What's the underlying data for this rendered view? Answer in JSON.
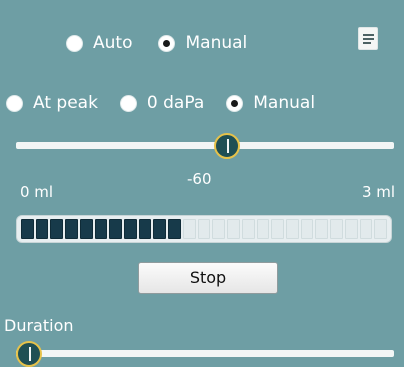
{
  "mode_group": {
    "options": [
      {
        "label": "Auto",
        "checked": false
      },
      {
        "label": "Manual",
        "checked": true
      }
    ]
  },
  "notes_icon": "notes-icon",
  "pressure_group": {
    "options": [
      {
        "label": "At peak",
        "checked": false
      },
      {
        "label": "0 daPa",
        "checked": false
      },
      {
        "label": "Manual",
        "checked": true
      }
    ]
  },
  "pressure_slider": {
    "level": 0.58
  },
  "scale": {
    "min_label": "0 ml",
    "current_label": "-60",
    "max_label": "3 ml"
  },
  "volume_meter": {
    "segments_total": 25,
    "segments_filled": 11
  },
  "stop_button": {
    "label": "Stop"
  },
  "duration": {
    "label": "Duration",
    "level": 0.0
  },
  "colors": {
    "background": "#6e9ea4",
    "meter_fill": "#173a4a",
    "thumb_ring": "#e6c24a"
  }
}
